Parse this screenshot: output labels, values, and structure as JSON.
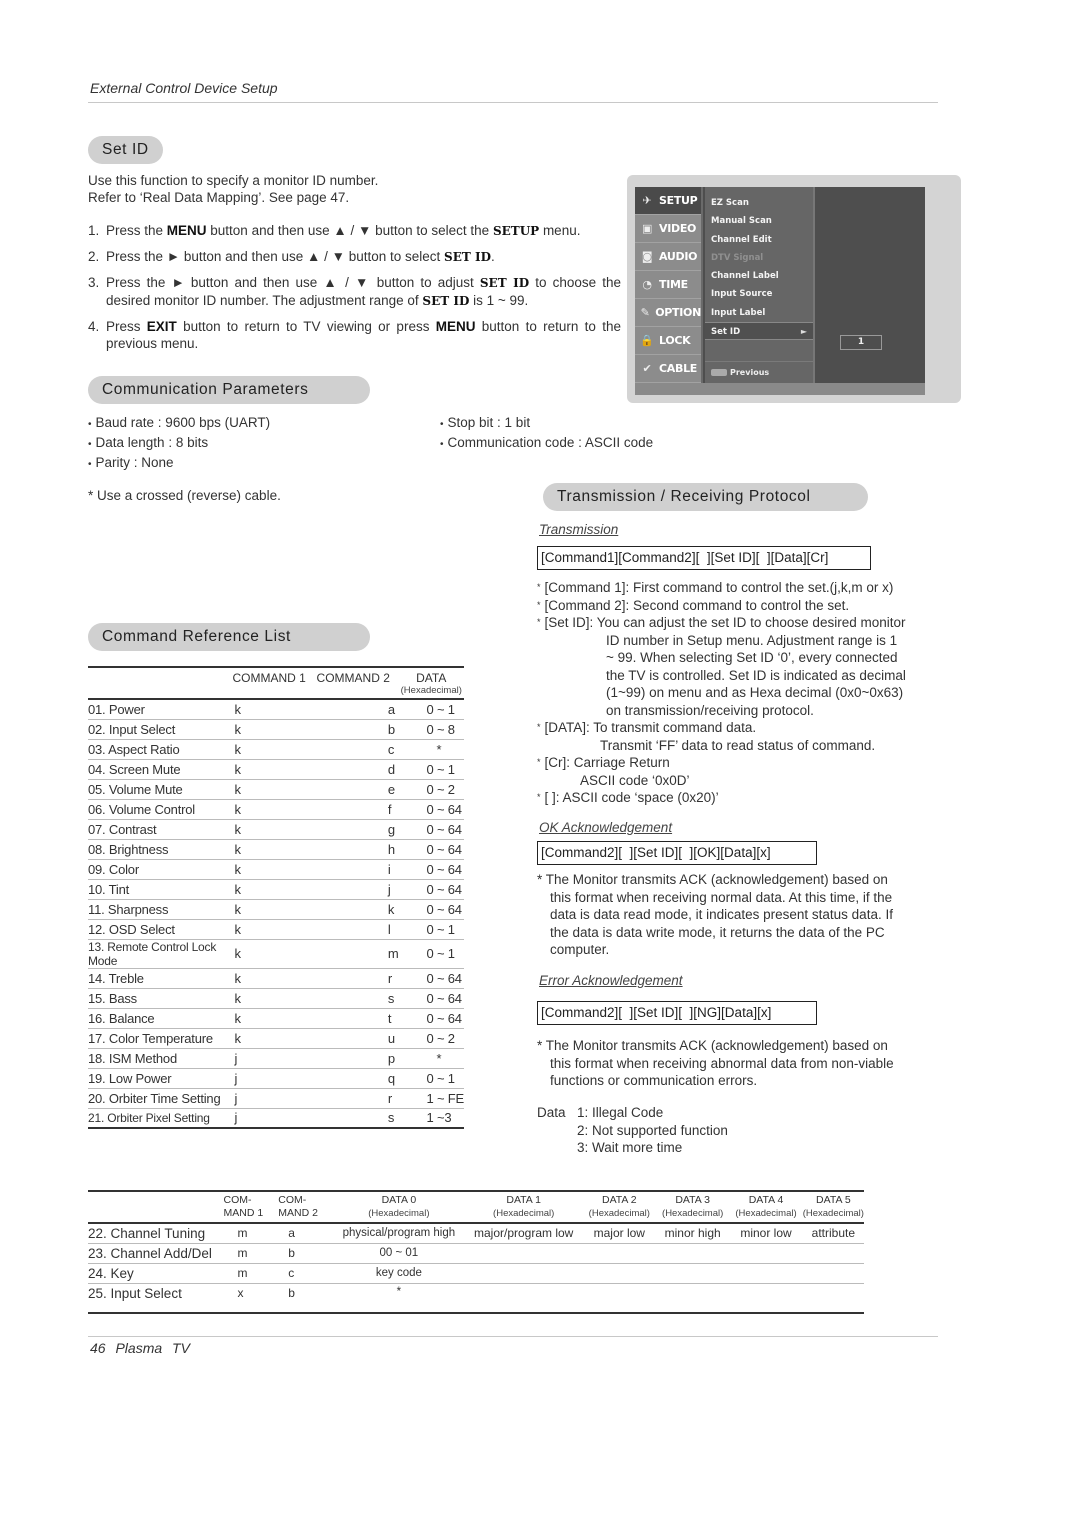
{
  "header": {
    "title": "External Control Device Setup"
  },
  "set_id": {
    "heading": "Set ID",
    "intro": [
      "Use this function to specify a monitor ID number.",
      "Refer to ‘Real Data Mapping’. See page 47."
    ],
    "steps": [
      {
        "num": "1.",
        "parts": [
          [
            "t",
            "Press the "
          ],
          [
            "b",
            "MENU"
          ],
          [
            "t",
            " button and then use ▲ / ▼ button to select the "
          ],
          [
            "sb",
            "SETUP"
          ],
          [
            "t",
            " menu."
          ]
        ]
      },
      {
        "num": "2.",
        "parts": [
          [
            "t",
            "Press the ► button and then use ▲ / ▼ button to select "
          ],
          [
            "sb",
            "SET ID"
          ],
          [
            "t",
            "."
          ]
        ]
      },
      {
        "num": "3.",
        "parts": [
          [
            "t",
            "Press the ► button and then use ▲ / ▼ button to adjust "
          ],
          [
            "sb",
            "SET ID"
          ],
          [
            "t",
            " to choose the desired monitor ID number. The adjustment range of "
          ],
          [
            "sb",
            "SET ID"
          ],
          [
            "t",
            " is 1 ~ 99."
          ]
        ]
      },
      {
        "num": "4.",
        "parts": [
          [
            "t",
            "Press "
          ],
          [
            "b",
            "EXIT"
          ],
          [
            "t",
            " button to return to TV viewing or press "
          ],
          [
            "b",
            "MENU"
          ],
          [
            "t",
            " button to return to the previous menu."
          ]
        ]
      }
    ]
  },
  "tv_menu": {
    "main_items": [
      {
        "label": "SETUP",
        "icon": "satellite-icon",
        "glyph": "✈",
        "active": true
      },
      {
        "label": "VIDEO",
        "icon": "screen-icon",
        "glyph": "▣",
        "active": false
      },
      {
        "label": "AUDIO",
        "icon": "speaker-icon",
        "glyph": "◙",
        "active": false
      },
      {
        "label": "TIME",
        "icon": "clock-icon",
        "glyph": "◔",
        "active": false
      },
      {
        "label": "OPTION",
        "icon": "wrench-icon",
        "glyph": "✎",
        "active": false
      },
      {
        "label": "LOCK",
        "icon": "padlock-icon",
        "glyph": "🔒",
        "active": false
      },
      {
        "label": "CABLE",
        "icon": "check-icon",
        "glyph": "✔",
        "active": false
      }
    ],
    "sub_items": [
      {
        "label": "EZ Scan",
        "state": "normal"
      },
      {
        "label": "Manual Scan",
        "state": "normal"
      },
      {
        "label": "Channel Edit",
        "state": "normal"
      },
      {
        "label": "DTV Signal",
        "state": "disabled"
      },
      {
        "label": "Channel Label",
        "state": "normal"
      },
      {
        "label": "Input Source",
        "state": "normal"
      },
      {
        "label": "Input Label",
        "state": "normal"
      },
      {
        "label": "Set ID",
        "state": "selected"
      }
    ],
    "previous_label": "Previous",
    "set_id_value": "1",
    "arrow": "►"
  },
  "comm_params": {
    "heading": "Communication Parameters",
    "left": [
      "Baud rate : 9600 bps (UART)",
      "Data length : 8 bits",
      "Parity : None"
    ],
    "right": [
      "Stop bit : 1 bit",
      "Communication code : ASCII code"
    ],
    "note": "* Use a crossed (reverse) cable."
  },
  "protocol": {
    "heading": "Transmission / Receiving  Protocol",
    "transmission_label": "Transmission",
    "transmission_format": "[Command1][Command2][  ][Set ID][  ][Data][Cr]",
    "bullets": [
      {
        "lines": [
          "[Command 1]: First command to control the set.(j,k,m or x)"
        ]
      },
      {
        "lines": [
          "[Command 2]: Second command to control the set."
        ]
      },
      {
        "lines": [
          "[Set ID]: You can adjust the set ID to choose desired monitor",
          "ID number in Setup menu. Adjustment range is 1",
          "~ 99. When selecting Set ID ‘0’, every connected",
          "the TV is controlled. Set ID is indicated as decimal",
          "(1~99) on menu and as Hexa decimal (0x0~0x63)",
          "on transmission/receiving protocol."
        ]
      },
      {
        "lines": [
          "[DATA]: To transmit command data.",
          "Transmit ‘FF’ data to read status of command."
        ]
      },
      {
        "lines": [
          "[Cr]: Carriage Return",
          "ASCII code ‘0x0D’"
        ]
      },
      {
        "lines": [
          "[   ]: ASCII code ‘space (0x20)’"
        ]
      }
    ],
    "ok_label": "OK Acknowledgement",
    "ok_format": "[Command2][  ][Set ID][  ][OK][Data][x]",
    "ok_note": [
      "* The Monitor transmits ACK (acknowledgement) based on",
      "this format when receiving normal data. At this time, if the",
      "data is data read mode, it indicates present status data. If",
      "the data is data write mode, it returns the data of the PC",
      "computer."
    ],
    "error_label": "Error Acknowledgement",
    "error_format": "[Command2][  ][Set ID][  ][NG][Data][x]",
    "error_note": [
      "* The Monitor transmits ACK (acknowledgement) based on",
      "this format when receiving abnormal data from non-viable",
      "functions or communication errors."
    ],
    "data_codes_label": "Data",
    "data_codes": [
      "1: Illegal Code",
      "2: Not supported function",
      "3: Wait more time"
    ]
  },
  "command_list": {
    "heading": "Command Reference List",
    "columns": [
      "",
      "COMMAND 1",
      "COMMAND 2",
      "DATA",
      "(Hexadecimal)"
    ],
    "rows": [
      [
        "01. Power",
        "k",
        "a",
        "0 ~ 1"
      ],
      [
        "02. Input Select",
        "k",
        "b",
        "0 ~ 8"
      ],
      [
        "03. Aspect Ratio",
        "k",
        "c",
        "*"
      ],
      [
        "04. Screen Mute",
        "k",
        "d",
        "0 ~ 1"
      ],
      [
        "05. Volume Mute",
        "k",
        "e",
        "0 ~ 2"
      ],
      [
        "06. Volume Control",
        "k",
        "f",
        "0 ~ 64"
      ],
      [
        "07. Contrast",
        "k",
        "g",
        "0 ~ 64"
      ],
      [
        "08. Brightness",
        "k",
        "h",
        "0 ~ 64"
      ],
      [
        "09. Color",
        "k",
        "i",
        "0 ~ 64"
      ],
      [
        "10. Tint",
        "k",
        "j",
        "0 ~ 64"
      ],
      [
        "11. Sharpness",
        "k",
        "k",
        "0 ~ 64"
      ],
      [
        "12. OSD Select",
        "k",
        "l",
        "0 ~ 1"
      ],
      [
        "13. Remote Control Lock Mode",
        "k",
        "m",
        "0 ~ 1"
      ],
      [
        "14. Treble",
        "k",
        "r",
        "0 ~ 64"
      ],
      [
        "15. Bass",
        "k",
        "s",
        "0 ~ 64"
      ],
      [
        "16. Balance",
        "k",
        "t",
        "0 ~ 64"
      ],
      [
        "17. Color Temperature",
        "k",
        "u",
        "0 ~ 2"
      ],
      [
        "18. ISM Method",
        "j",
        "p",
        "*"
      ],
      [
        "19. Low Power",
        "j",
        "q",
        "0 ~ 1"
      ],
      [
        "20. Orbiter Time Setting",
        "j",
        "r",
        "1 ~ FE"
      ],
      [
        "21. Orbiter Pixel Setting",
        "j",
        "s",
        "1 ~3"
      ]
    ]
  },
  "extended_list": {
    "columns": [
      {
        "top": "",
        "bottom": ""
      },
      {
        "top": "COM-",
        "bottom": "MAND 1"
      },
      {
        "top": "COM-",
        "bottom": "MAND 2"
      },
      {
        "top": "DATA 0",
        "bottom": "(Hexadecimal)"
      },
      {
        "top": "DATA 1",
        "bottom": "(Hexadecimal)"
      },
      {
        "top": "DATA 2",
        "bottom": "(Hexadecimal)"
      },
      {
        "top": "DATA 3",
        "bottom": "(Hexadecimal)"
      },
      {
        "top": "DATA 4",
        "bottom": "(Hexadecimal)"
      },
      {
        "top": "DATA 5",
        "bottom": "(Hexadecimal)"
      }
    ],
    "rows": [
      [
        "22. Channel Tuning",
        "m",
        "a",
        "physical/program high",
        "major/program low",
        "major low",
        "minor high",
        "minor low",
        "attribute"
      ],
      [
        "23. Channel Add/Del",
        "m",
        "b",
        "00 ~ 01",
        "",
        "",
        "",
        "",
        ""
      ],
      [
        "24. Key",
        "m",
        "c",
        "key code",
        "",
        "",
        "",
        "",
        ""
      ],
      [
        "25. Input Select",
        "x",
        "b",
        "*",
        "",
        "",
        "",
        "",
        ""
      ]
    ]
  },
  "footer": {
    "page": "46",
    "title": "Plasma TV"
  }
}
